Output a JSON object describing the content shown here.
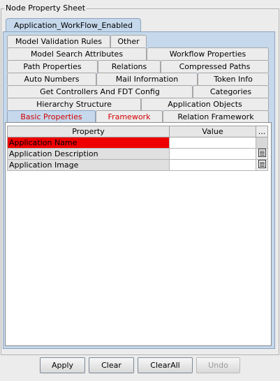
{
  "panel": {
    "title": "Node Property Sheet"
  },
  "top_tab": "Application_WorkFlow_Enabled",
  "tabs": {
    "row1": [
      "Model Validation Rules",
      "Other"
    ],
    "row2": [
      "Model Search Attributes",
      "Workflow Properties"
    ],
    "row3": [
      "Path Properties",
      "Relations",
      "Compressed Paths"
    ],
    "row4": [
      "Auto Numbers",
      "Mail Information",
      "Token Info"
    ],
    "row5": [
      "Get Controllers And FDT Config",
      "Categories"
    ],
    "row6": [
      "Hierarchy Structure",
      "Application Objects"
    ],
    "row7": [
      "Basic Properties",
      "Framework",
      "Relation Framework"
    ]
  },
  "table": {
    "headers": [
      "Property",
      "Value",
      "..."
    ],
    "rows": [
      {
        "property": "Application Name",
        "value": ""
      },
      {
        "property": "Application Description",
        "value": ""
      },
      {
        "property": "Application Image",
        "value": ""
      }
    ]
  },
  "buttons": {
    "apply": "Apply",
    "clear": "Clear",
    "clear_all": "ClearAll",
    "undo": "Undo"
  },
  "colors": {
    "tab_blue": "#c5d8ec",
    "highlight_red": "#ef0000",
    "tab_red_text": "#d40000"
  }
}
